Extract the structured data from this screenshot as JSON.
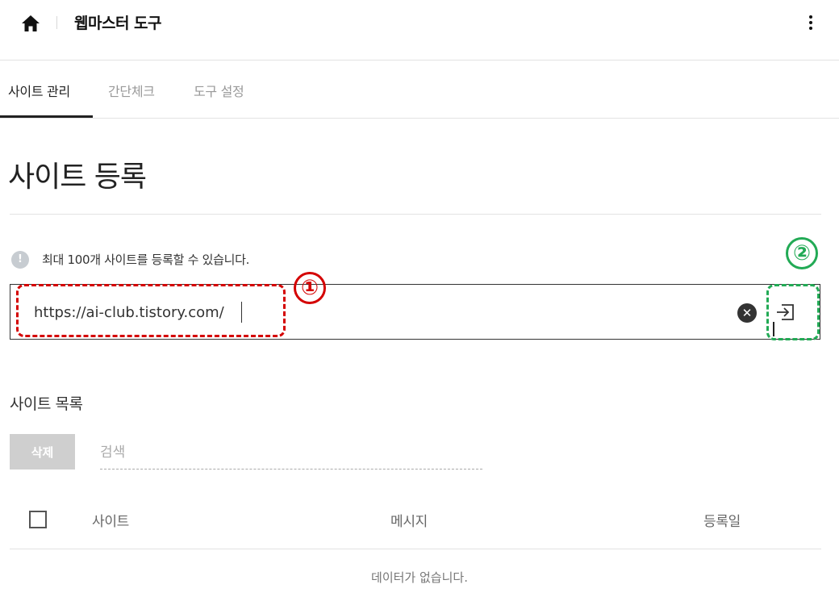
{
  "header": {
    "title": "웹마스터 도구",
    "home_icon": "home-icon",
    "more_icon": "more-vert-icon"
  },
  "tabs": [
    {
      "label": "사이트 관리",
      "active": true
    },
    {
      "label": "간단체크",
      "active": false
    },
    {
      "label": "도구 설정",
      "active": false
    }
  ],
  "section": {
    "title": "사이트 등록",
    "notice": "최대 100개 사이트를 등록할 수 있습니다.",
    "url_value": "https://ai-club.tistory.com/"
  },
  "annotations": {
    "one": "①",
    "two": "②"
  },
  "site_list": {
    "title": "사이트 목록",
    "delete_label": "삭제",
    "search_placeholder": "검색",
    "columns": [
      "사이트",
      "메시지",
      "등록일"
    ],
    "empty_text": "데이터가 없습니다."
  },
  "colors": {
    "annotation_red": "#d40000",
    "annotation_green": "#22aa55",
    "disabled_button": "#cfcfcf"
  }
}
